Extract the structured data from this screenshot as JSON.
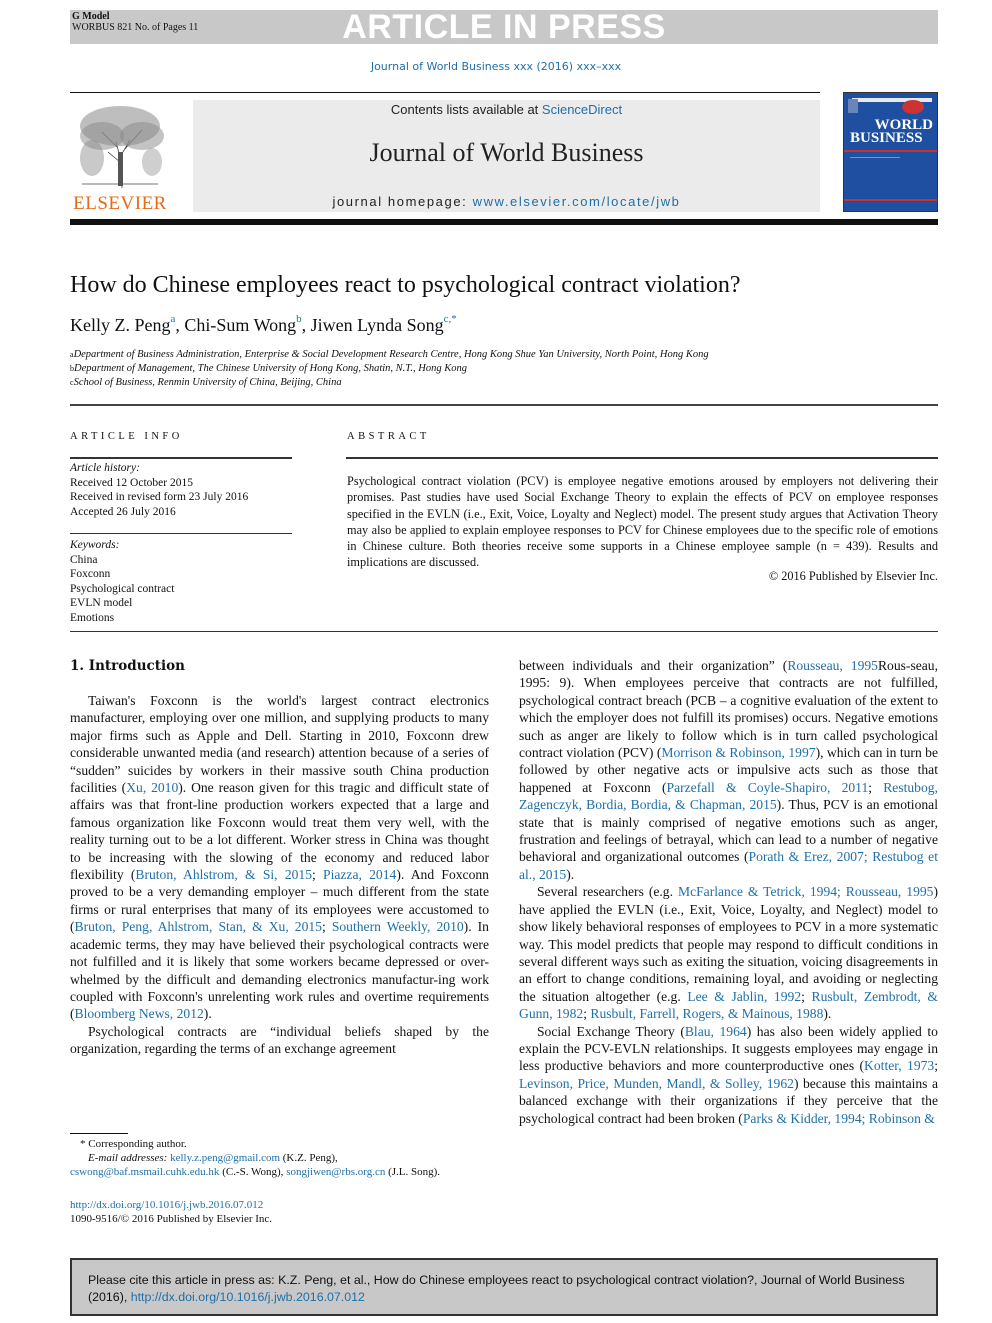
{
  "press_header": {
    "gmodel": "G Model",
    "ref_line": "WORBUS 821 No. of Pages 11",
    "banner": "ARTICLE IN PRESS"
  },
  "journal_line": "Journal of World Business xxx (2016) xxx–xxx",
  "masthead": {
    "publisher_logo_text": "ELSEVIER",
    "contents_prefix": "Contents lists available at ",
    "contents_link": "ScienceDirect",
    "journal_title": "Journal of World Business",
    "homepage_prefix": "journal homepage: ",
    "homepage_link": "www.elsevier.com/locate/jwb",
    "cover": {
      "line1": "WORLD",
      "line2": "BUSINESS"
    }
  },
  "article": {
    "title": "How do Chinese employees react to psychological contract violation?",
    "authors": [
      {
        "name": "Kelly Z. Peng",
        "sup": "a"
      },
      {
        "name": "Chi-Sum Wong",
        "sup": "b"
      },
      {
        "name": "Jiwen Lynda Song",
        "sup": "c,*"
      }
    ],
    "affiliations": [
      {
        "sup": "a",
        "text": "Department of Business Administration, Enterprise & Social Development Research Centre, Hong Kong Shue Yan University, North Point, Hong Kong"
      },
      {
        "sup": "b",
        "text": "Department of Management, The Chinese University of Hong Kong, Shatin, N.T., Hong Kong"
      },
      {
        "sup": "c",
        "text": "School of Business, Renmin University of China, Beijing, China"
      }
    ]
  },
  "article_info": {
    "heading": "ARTICLE INFO",
    "history_label": "Article history:",
    "history": [
      "Received 12 October 2015",
      "Received in revised form 23 July 2016",
      "Accepted 26 July 2016"
    ],
    "keywords_label": "Keywords:",
    "keywords": [
      "China",
      "Foxconn",
      "Psychological contract",
      "EVLN model",
      "Emotions"
    ]
  },
  "abstract": {
    "heading": "ABSTRACT",
    "text": "Psychological contract violation (PCV) is employee negative emotions aroused by employers not delivering their promises. Past studies have used Social Exchange Theory to explain the effects of PCV on employee responses specified in the EVLN (i.e., Exit, Voice, Loyalty and Neglect) model. The present study argues that Activation Theory may also be applied to explain employee responses to PCV for Chinese employees due to the specific role of emotions in Chinese culture. Both theories receive some supports in a Chinese employee sample (n = 439). Results and implications are discussed.",
    "copyright": "© 2016 Published by Elsevier Inc."
  },
  "body": {
    "section_heading": "1. Introduction",
    "left_paragraphs": [
      [
        {
          "t": "Taiwan's Foxconn is the world's largest contract electronics manufacturer, employing over one million, and supplying products to many major firms such as Apple and Dell. Starting in 2010, Foxconn drew considerable unwanted media (and research) attention because of a series of “sudden” suicides by workers in their massive south China production facilities ("
        },
        {
          "t": "Xu, 2010",
          "link": true
        },
        {
          "t": "). One reason given for this tragic and difficult state of affairs was that front-line production workers expected that a large and famous organization like Foxconn would treat them very well, with the reality turning out to be a lot different. Worker stress in China was thought to be increasing with the slowing of the economy and reduced labor flexibility ("
        },
        {
          "t": "Bruton, Ahlstrom, & Si, 2015",
          "link": true
        },
        {
          "t": "; "
        },
        {
          "t": "Piazza, 2014",
          "link": true
        },
        {
          "t": "). And Foxconn proved to be a very demanding employer – much different from the state firms or rural enterprises that many of its employees were accustomed to ("
        },
        {
          "t": "Bruton, Peng, Ahlstrom, Stan, & Xu, 2015",
          "link": true
        },
        {
          "t": "; "
        },
        {
          "t": "Southern Weekly, 2010",
          "link": true
        },
        {
          "t": "). In academic terms, they may have believed their psychological contracts were not fulfilled and it is likely that some workers became depressed or over-whelmed by the difficult and demanding electronics manufactur-ing work coupled with Foxconn's unrelenting work rules and overtime requirements ("
        },
        {
          "t": "Bloomberg News, 2012",
          "link": true
        },
        {
          "t": ")."
        }
      ],
      [
        {
          "t": "Psychological contracts are “individual beliefs shaped by the organization, regarding the terms of an exchange agreement"
        }
      ]
    ],
    "right_paragraphs": [
      [
        {
          "t": "between individuals and their organization” ("
        },
        {
          "t": "Rousseau, 1995",
          "link": true
        },
        {
          "t": "Rous-seau, 1995: 9). When employees perceive that contracts are not fulfilled, psychological contract breach (PCB – a cognitive evaluation of the extent to which the employer does not fulfill its promises) occurs. Negative emotions such as anger are likely to follow which is in turn called psychological contract violation (PCV) ("
        },
        {
          "t": "Morrison & Robinson, 1997",
          "link": true
        },
        {
          "t": "), which can in turn be followed by other negative acts or impulsive acts such as those that happened at Foxconn ("
        },
        {
          "t": "Parzefall & Coyle-Shapiro, 2011",
          "link": true
        },
        {
          "t": "; "
        },
        {
          "t": "Restubog, Zagenczyk, Bordia, Bordia, & Chapman, 2015",
          "link": true
        },
        {
          "t": "). Thus, PCV is an emotional state that is mainly comprised of negative emotions such as anger, frustration and feelings of betrayal, which can lead to a number of negative behavioral and organizational outcomes ("
        },
        {
          "t": "Porath & Erez, 2007; Restubog et al., 2015",
          "link": true
        },
        {
          "t": ")."
        }
      ],
      [
        {
          "t": "Several researchers (e.g. "
        },
        {
          "t": "McFarlance & Tetrick, 1994; Rousseau, 1995",
          "link": true
        },
        {
          "t": ") have applied the EVLN (i.e., Exit, Voice, Loyalty, and Neglect) model to show likely behavioral responses of employees to PCV in a more systematic way. This model predicts that people may respond to difficult conditions in several different ways such as exiting the situation, voicing disagreements in an effort to change conditions, remaining loyal, and avoiding or neglecting the situation altogether (e.g. "
        },
        {
          "t": "Lee & Jablin, 1992",
          "link": true
        },
        {
          "t": "; "
        },
        {
          "t": "Rusbult, Zembrodt, & Gunn, 1982",
          "link": true
        },
        {
          "t": "; "
        },
        {
          "t": "Rusbult, Farrell, Rogers, & Mainous, 1988",
          "link": true
        },
        {
          "t": ")."
        }
      ],
      [
        {
          "t": "Social Exchange Theory ("
        },
        {
          "t": "Blau, 1964",
          "link": true
        },
        {
          "t": ") has also been widely applied to explain the PCV-EVLN relationships. It suggests employees may engage in less productive behaviors and more counterproductive ones ("
        },
        {
          "t": "Kotter, 1973",
          "link": true
        },
        {
          "t": "; "
        },
        {
          "t": "Levinson, Price, Munden, Mandl, & Solley, 1962",
          "link": true
        },
        {
          "t": ") because this maintains a balanced exchange with their organizations if they perceive that the psychological contract had been broken ("
        },
        {
          "t": "Parks & Kidder, 1994; Robinson &",
          "link": true
        }
      ]
    ]
  },
  "footnotes": {
    "corresponding": "* Corresponding author.",
    "email_label": "E-mail addresses: ",
    "emails": [
      {
        "addr": "kelly.z.peng@gmail.com",
        "who": " (K.Z.  Peng),",
        "newline_after": true
      },
      {
        "addr": "cswong@baf.msmail.cuhk.edu.hk",
        "who": " (C.-S. Wong), "
      },
      {
        "addr": "songjiwen@rbs.org.cn",
        "who": " (J.L. Song)."
      }
    ]
  },
  "doi": {
    "link": "http://dx.doi.org/10.1016/j.jwb.2016.07.012",
    "issn_line": "1090-9516/© 2016 Published by Elsevier Inc."
  },
  "cite_box": {
    "text": "Please cite this article in press as: K.Z. Peng, et al., How do Chinese employees react to psychological contract violation?, Journal of World Business (2016), ",
    "link": "http://dx.doi.org/10.1016/j.jwb.2016.07.012"
  }
}
